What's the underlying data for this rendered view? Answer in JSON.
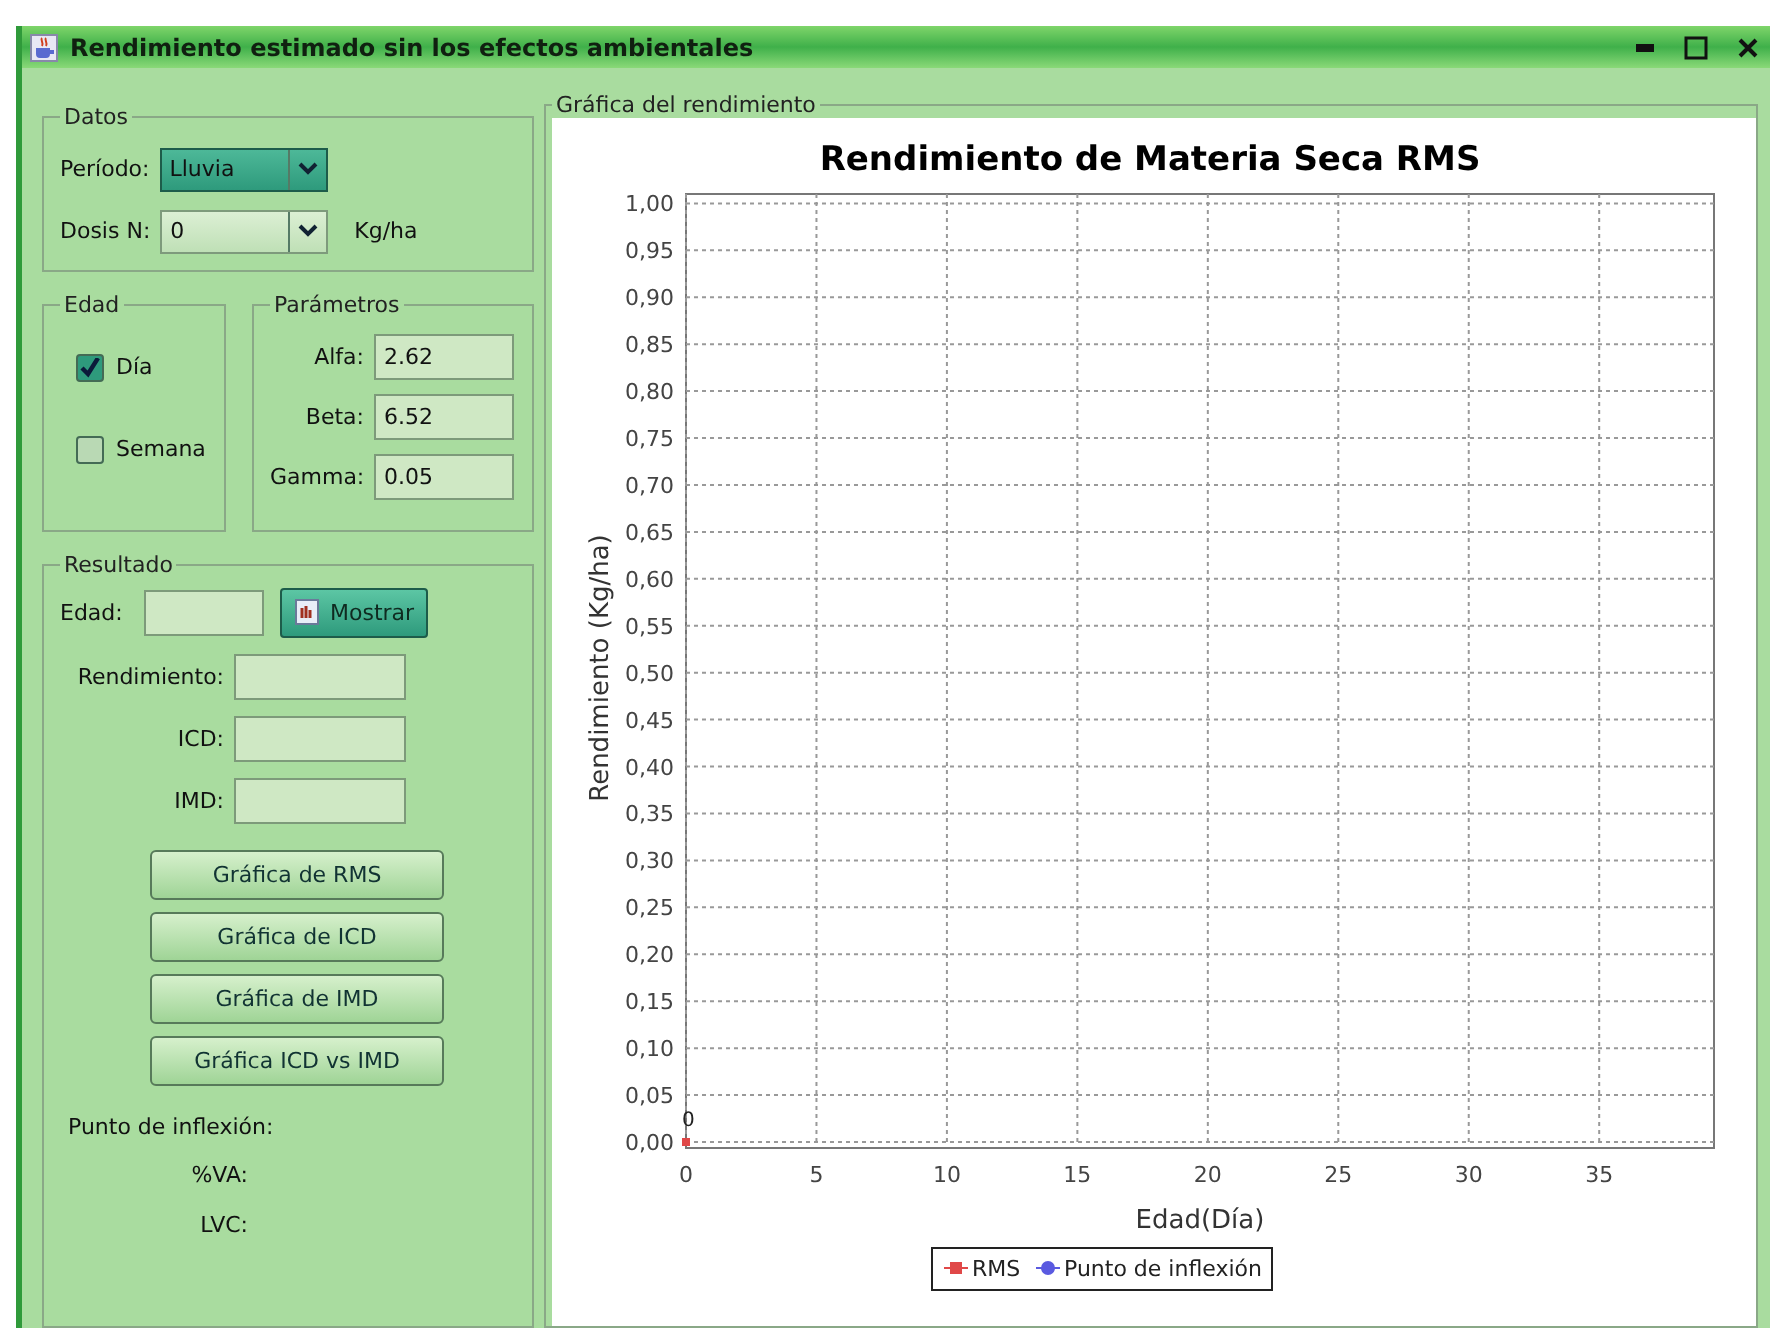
{
  "window": {
    "title": "Rendimiento estimado sin los efectos ambientales"
  },
  "datos": {
    "legend": "Datos",
    "fields": [
      {
        "label": "Período:",
        "value": "Lluvia",
        "focused": true
      },
      {
        "label": "Dosis N:",
        "value": "0",
        "focused": false,
        "unit": "Kg/ha"
      }
    ]
  },
  "edad": {
    "legend": "Edad",
    "options": [
      {
        "label": "Día",
        "checked": true
      },
      {
        "label": "Semana",
        "checked": false
      }
    ]
  },
  "parametros": {
    "legend": "Parámetros",
    "fields": [
      {
        "label": "Alfa:",
        "value": "2.62"
      },
      {
        "label": "Beta:",
        "value": "6.52"
      },
      {
        "label": "Gamma:",
        "value": "0.05"
      }
    ]
  },
  "resultado": {
    "legend": "Resultado",
    "edad_label": "Edad:",
    "mostrar_button": "Mostrar",
    "fields": [
      {
        "label": "Rendimiento:"
      },
      {
        "label": "ICD:"
      },
      {
        "label": "IMD:"
      }
    ],
    "buttons": [
      "Gráfica de RMS",
      "Gráfica de ICD",
      "Gráfica de IMD",
      "Gráfica ICD vs IMD"
    ],
    "inflexion_label": "Punto de inflexión:",
    "outputs": [
      "%VA:",
      "LVC:"
    ]
  },
  "chart_panel": {
    "legend": "Gráfica del rendimiento",
    "chart_data": {
      "type": "line",
      "title": "Rendimiento de Materia Seca RMS",
      "xlabel": "Edad(Día)",
      "ylabel": "Rendimiento (Kg/ha)",
      "xlim": [
        0,
        39.4
      ],
      "ylim": [
        0,
        1.01
      ],
      "xticks": [
        0,
        5,
        10,
        15,
        20,
        25,
        30,
        35
      ],
      "yticks": [
        {
          "value": 0,
          "label": "0,00"
        },
        {
          "value": 0.05,
          "label": "0,05"
        },
        {
          "value": 0.1,
          "label": "0,10"
        },
        {
          "value": 0.15,
          "label": "0,15"
        },
        {
          "value": 0.2,
          "label": "0,20"
        },
        {
          "value": 0.25,
          "label": "0,25"
        },
        {
          "value": 0.3,
          "label": "0,30"
        },
        {
          "value": 0.35,
          "label": "0,35"
        },
        {
          "value": 0.4,
          "label": "0,40"
        },
        {
          "value": 0.45,
          "label": "0,45"
        },
        {
          "value": 0.5,
          "label": "0,50"
        },
        {
          "value": 0.55,
          "label": "0,55"
        },
        {
          "value": 0.6,
          "label": "0,60"
        },
        {
          "value": 0.65,
          "label": "0,65"
        },
        {
          "value": 0.7,
          "label": "0,70"
        },
        {
          "value": 0.75,
          "label": "0,75"
        },
        {
          "value": 0.8,
          "label": "0,80"
        },
        {
          "value": 0.85,
          "label": "0,85"
        },
        {
          "value": 0.9,
          "label": "0,90"
        },
        {
          "value": 0.95,
          "label": "0,95"
        },
        {
          "value": 1,
          "label": "1,00"
        }
      ],
      "x": [
        0
      ],
      "series": [
        {
          "name": "RMS",
          "color": "#e04848",
          "marker": "square",
          "values": [
            0
          ]
        },
        {
          "name": "Punto de inflexión",
          "color": "#5a5ae0",
          "marker": "circle",
          "values": [
            null
          ]
        }
      ],
      "grid": true,
      "annotations": [
        "0"
      ]
    }
  }
}
